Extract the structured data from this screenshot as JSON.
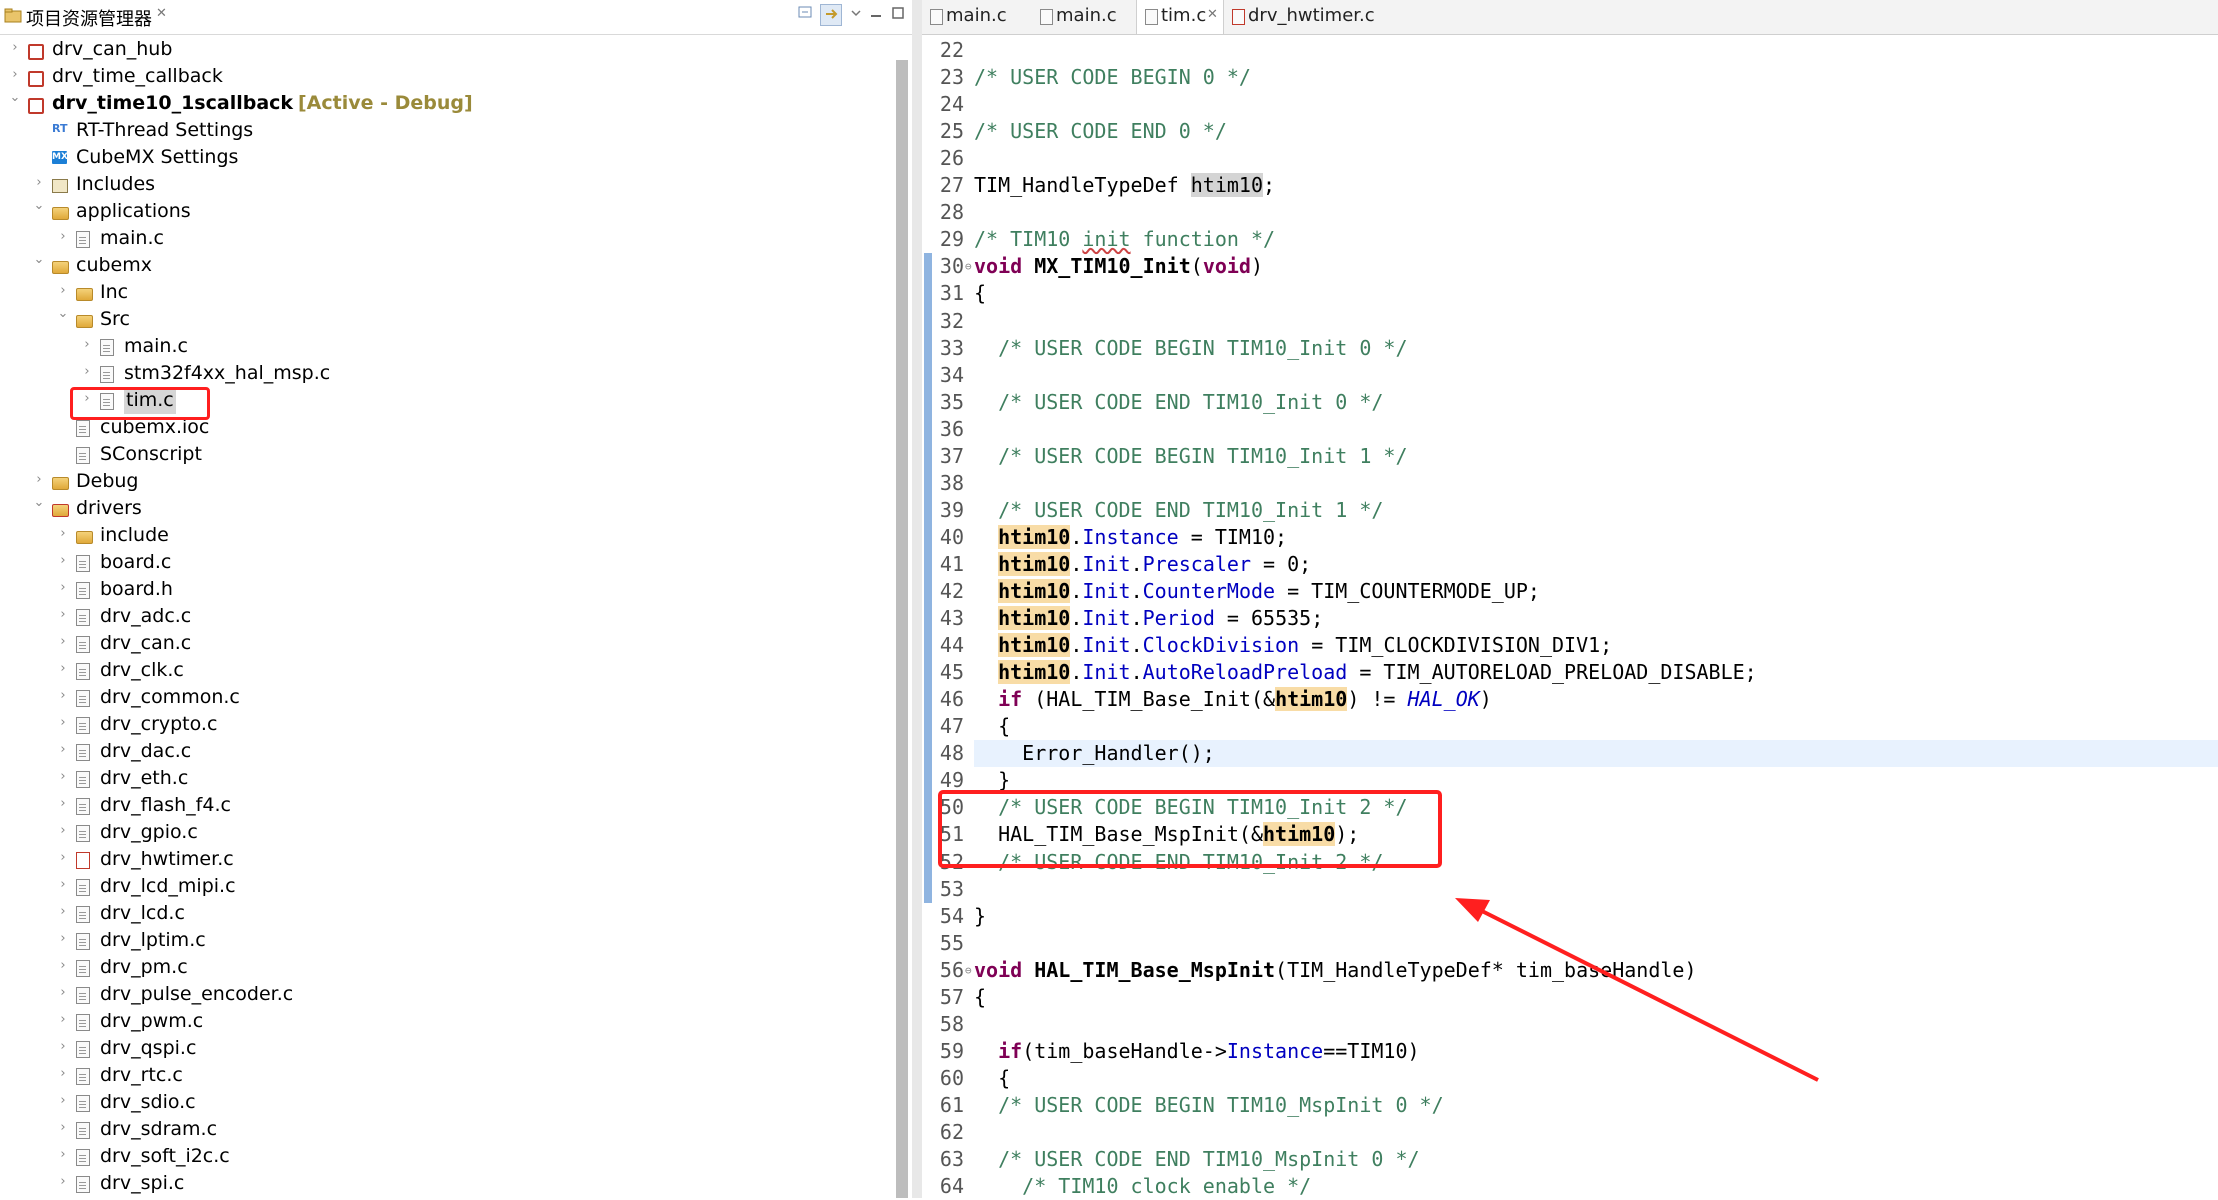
{
  "explorer": {
    "title": "项目资源管理器",
    "close": "✕",
    "toolbar": [
      "collapse",
      "link",
      "menu",
      "minimize",
      "maximize"
    ],
    "items": [
      {
        "label": "drv_can_hub",
        "depth": 0,
        "arrow": "›",
        "icon": "project",
        "bold": false
      },
      {
        "label": "drv_time_callback",
        "depth": 0,
        "arrow": "›",
        "icon": "project",
        "bold": false
      },
      {
        "label": "drv_time10_1scallback",
        "depth": 0,
        "arrow": "⌄",
        "icon": "project",
        "bold": true,
        "deco": "[Active - Debug]"
      },
      {
        "label": "RT-Thread Settings",
        "depth": 1,
        "arrow": "",
        "icon": "rt",
        "bold": false
      },
      {
        "label": "CubeMX Settings",
        "depth": 1,
        "arrow": "",
        "icon": "mx",
        "bold": false
      },
      {
        "label": "Includes",
        "depth": 1,
        "arrow": "›",
        "icon": "includes",
        "bold": false
      },
      {
        "label": "applications",
        "depth": 1,
        "arrow": "⌄",
        "icon": "folder",
        "bold": false
      },
      {
        "label": "main.c",
        "depth": 2,
        "arrow": "›",
        "icon": "file",
        "bold": false
      },
      {
        "label": "cubemx",
        "depth": 1,
        "arrow": "⌄",
        "icon": "folder",
        "bold": false
      },
      {
        "label": "Inc",
        "depth": 2,
        "arrow": "›",
        "icon": "folder",
        "bold": false
      },
      {
        "label": "Src",
        "depth": 2,
        "arrow": "⌄",
        "icon": "folder",
        "bold": false
      },
      {
        "label": "main.c",
        "depth": 3,
        "arrow": "›",
        "icon": "file",
        "bold": false
      },
      {
        "label": "stm32f4xx_hal_msp.c",
        "depth": 3,
        "arrow": "›",
        "icon": "file",
        "bold": false
      },
      {
        "label": "tim.c",
        "depth": 3,
        "arrow": "›",
        "icon": "file",
        "bold": false,
        "selected": true
      },
      {
        "label": "cubemx.ioc",
        "depth": 2,
        "arrow": "",
        "icon": "file",
        "bold": false
      },
      {
        "label": "SConscript",
        "depth": 2,
        "arrow": "",
        "icon": "file",
        "bold": false
      },
      {
        "label": "Debug",
        "depth": 1,
        "arrow": "›",
        "icon": "folder",
        "bold": false
      },
      {
        "label": "drivers",
        "depth": 1,
        "arrow": "⌄",
        "icon": "folder-red",
        "bold": false
      },
      {
        "label": "include",
        "depth": 2,
        "arrow": "›",
        "icon": "folder",
        "bold": false
      },
      {
        "label": "board.c",
        "depth": 2,
        "arrow": "›",
        "icon": "file",
        "bold": false
      },
      {
        "label": "board.h",
        "depth": 2,
        "arrow": "›",
        "icon": "file",
        "bold": false
      },
      {
        "label": "drv_adc.c",
        "depth": 2,
        "arrow": "›",
        "icon": "file",
        "bold": false
      },
      {
        "label": "drv_can.c",
        "depth": 2,
        "arrow": "›",
        "icon": "file",
        "bold": false
      },
      {
        "label": "drv_clk.c",
        "depth": 2,
        "arrow": "›",
        "icon": "file",
        "bold": false
      },
      {
        "label": "drv_common.c",
        "depth": 2,
        "arrow": "›",
        "icon": "file",
        "bold": false
      },
      {
        "label": "drv_crypto.c",
        "depth": 2,
        "arrow": "›",
        "icon": "file",
        "bold": false
      },
      {
        "label": "drv_dac.c",
        "depth": 2,
        "arrow": "›",
        "icon": "file",
        "bold": false
      },
      {
        "label": "drv_eth.c",
        "depth": 2,
        "arrow": "›",
        "icon": "file",
        "bold": false
      },
      {
        "label": "drv_flash_f4.c",
        "depth": 2,
        "arrow": "›",
        "icon": "file",
        "bold": false
      },
      {
        "label": "drv_gpio.c",
        "depth": 2,
        "arrow": "›",
        "icon": "file",
        "bold": false
      },
      {
        "label": "drv_hwtimer.c",
        "depth": 2,
        "arrow": "›",
        "icon": "file-red",
        "bold": false
      },
      {
        "label": "drv_lcd_mipi.c",
        "depth": 2,
        "arrow": "›",
        "icon": "file",
        "bold": false
      },
      {
        "label": "drv_lcd.c",
        "depth": 2,
        "arrow": "›",
        "icon": "file",
        "bold": false
      },
      {
        "label": "drv_lptim.c",
        "depth": 2,
        "arrow": "›",
        "icon": "file",
        "bold": false
      },
      {
        "label": "drv_pm.c",
        "depth": 2,
        "arrow": "›",
        "icon": "file",
        "bold": false
      },
      {
        "label": "drv_pulse_encoder.c",
        "depth": 2,
        "arrow": "›",
        "icon": "file",
        "bold": false
      },
      {
        "label": "drv_pwm.c",
        "depth": 2,
        "arrow": "›",
        "icon": "file",
        "bold": false
      },
      {
        "label": "drv_qspi.c",
        "depth": 2,
        "arrow": "›",
        "icon": "file",
        "bold": false
      },
      {
        "label": "drv_rtc.c",
        "depth": 2,
        "arrow": "›",
        "icon": "file",
        "bold": false
      },
      {
        "label": "drv_sdio.c",
        "depth": 2,
        "arrow": "›",
        "icon": "file",
        "bold": false
      },
      {
        "label": "drv_sdram.c",
        "depth": 2,
        "arrow": "›",
        "icon": "file",
        "bold": false
      },
      {
        "label": "drv_soft_i2c.c",
        "depth": 2,
        "arrow": "›",
        "icon": "file",
        "bold": false
      },
      {
        "label": "drv_spi.c",
        "depth": 2,
        "arrow": "›",
        "icon": "file",
        "bold": false
      }
    ]
  },
  "editor": {
    "tabs": [
      {
        "label": "main.c",
        "active": false,
        "icon": "file"
      },
      {
        "label": "main.c",
        "active": false,
        "icon": "file"
      },
      {
        "label": "tim.c",
        "active": true,
        "icon": "file",
        "close": "✕"
      },
      {
        "label": "drv_hwtimer.c",
        "active": false,
        "icon": "file-red"
      }
    ],
    "lines": [
      {
        "n": "22",
        "tokens": []
      },
      {
        "n": "23",
        "tokens": [
          [
            "cm",
            "/* USER CODE BEGIN 0 */"
          ]
        ]
      },
      {
        "n": "24",
        "tokens": []
      },
      {
        "n": "25",
        "tokens": [
          [
            "cm",
            "/* USER CODE END 0 */"
          ]
        ]
      },
      {
        "n": "26",
        "tokens": []
      },
      {
        "n": "27",
        "tokens": [
          [
            "",
            "TIM_HandleTypeDef "
          ],
          [
            "occ2",
            "htim10"
          ],
          [
            "",
            ";"
          ]
        ]
      },
      {
        "n": "28",
        "tokens": []
      },
      {
        "n": "29",
        "tokens": [
          [
            "cm",
            "/* TIM10 "
          ],
          [
            "cm under",
            "init"
          ],
          [
            "cm",
            " function */"
          ]
        ]
      },
      {
        "n": "30",
        "fold": true,
        "tokens": [
          [
            "kw",
            "void"
          ],
          [
            "",
            " "
          ],
          [
            "fn",
            "MX_TIM10_Init"
          ],
          [
            "",
            "("
          ],
          [
            "kw",
            "void"
          ],
          [
            "",
            ")"
          ]
        ]
      },
      {
        "n": "31",
        "tokens": [
          [
            "",
            "{"
          ]
        ]
      },
      {
        "n": "32",
        "tokens": []
      },
      {
        "n": "33",
        "tokens": [
          [
            "",
            "  "
          ],
          [
            "cm",
            "/* USER CODE BEGIN TIM10_Init 0 */"
          ]
        ]
      },
      {
        "n": "34",
        "tokens": []
      },
      {
        "n": "35",
        "tokens": [
          [
            "",
            "  "
          ],
          [
            "cm",
            "/* USER CODE END TIM10_Init 0 */"
          ]
        ]
      },
      {
        "n": "36",
        "tokens": []
      },
      {
        "n": "37",
        "tokens": [
          [
            "",
            "  "
          ],
          [
            "cm",
            "/* USER CODE BEGIN TIM10_Init 1 */"
          ]
        ]
      },
      {
        "n": "38",
        "tokens": []
      },
      {
        "n": "39",
        "tokens": [
          [
            "",
            "  "
          ],
          [
            "cm",
            "/* USER CODE END TIM10_Init 1 */"
          ]
        ]
      },
      {
        "n": "40",
        "tokens": [
          [
            "",
            "  "
          ],
          [
            "occ",
            "htim10"
          ],
          [
            "",
            "."
          ],
          [
            "fld",
            "Instance"
          ],
          [
            "",
            " = TIM10;"
          ]
        ]
      },
      {
        "n": "41",
        "tokens": [
          [
            "",
            "  "
          ],
          [
            "occ",
            "htim10"
          ],
          [
            "",
            "."
          ],
          [
            "fld",
            "Init"
          ],
          [
            "",
            "."
          ],
          [
            "fld",
            "Prescaler"
          ],
          [
            "",
            " = 0;"
          ]
        ]
      },
      {
        "n": "42",
        "tokens": [
          [
            "",
            "  "
          ],
          [
            "occ",
            "htim10"
          ],
          [
            "",
            "."
          ],
          [
            "fld",
            "Init"
          ],
          [
            "",
            "."
          ],
          [
            "fld",
            "CounterMode"
          ],
          [
            "",
            " = TIM_COUNTERMODE_UP;"
          ]
        ]
      },
      {
        "n": "43",
        "tokens": [
          [
            "",
            "  "
          ],
          [
            "occ",
            "htim10"
          ],
          [
            "",
            "."
          ],
          [
            "fld",
            "Init"
          ],
          [
            "",
            "."
          ],
          [
            "fld",
            "Period"
          ],
          [
            "",
            " = 65535;"
          ]
        ]
      },
      {
        "n": "44",
        "tokens": [
          [
            "",
            "  "
          ],
          [
            "occ",
            "htim10"
          ],
          [
            "",
            "."
          ],
          [
            "fld",
            "Init"
          ],
          [
            "",
            "."
          ],
          [
            "fld",
            "ClockDivision"
          ],
          [
            "",
            " = TIM_CLOCKDIVISION_DIV1;"
          ]
        ]
      },
      {
        "n": "45",
        "tokens": [
          [
            "",
            "  "
          ],
          [
            "occ",
            "htim10"
          ],
          [
            "",
            "."
          ],
          [
            "fld",
            "Init"
          ],
          [
            "",
            "."
          ],
          [
            "fld",
            "AutoReloadPreload"
          ],
          [
            "",
            " = TIM_AUTORELOAD_PRELOAD_DISABLE;"
          ]
        ]
      },
      {
        "n": "46",
        "tokens": [
          [
            "",
            "  "
          ],
          [
            "kw",
            "if"
          ],
          [
            "",
            " (HAL_TIM_Base_Init(&"
          ],
          [
            "occ",
            "htim10"
          ],
          [
            "",
            ") != "
          ],
          [
            "ital",
            "HAL_OK"
          ],
          [
            "",
            ")"
          ]
        ]
      },
      {
        "n": "47",
        "tokens": [
          [
            "",
            "  {"
          ]
        ]
      },
      {
        "n": "48",
        "hl": true,
        "tokens": [
          [
            "",
            "    Error_Handler();"
          ]
        ]
      },
      {
        "n": "49",
        "tokens": [
          [
            "",
            "  }"
          ]
        ]
      },
      {
        "n": "50",
        "tokens": [
          [
            "",
            "  "
          ],
          [
            "cm",
            "/* USER CODE BEGIN TIM10_Init 2 */"
          ]
        ]
      },
      {
        "n": "51",
        "tokens": [
          [
            "",
            "  HAL_TIM_Base_MspInit(&"
          ],
          [
            "occ",
            "htim10"
          ],
          [
            "",
            ");"
          ]
        ]
      },
      {
        "n": "52",
        "tokens": [
          [
            "",
            "  "
          ],
          [
            "cm",
            "/* USER CODE END TIM10_Init 2 */"
          ]
        ]
      },
      {
        "n": "53",
        "tokens": []
      },
      {
        "n": "54",
        "tokens": [
          [
            "",
            "}"
          ]
        ]
      },
      {
        "n": "55",
        "tokens": []
      },
      {
        "n": "56",
        "fold": true,
        "tokens": [
          [
            "kw",
            "void"
          ],
          [
            "",
            " "
          ],
          [
            "fn",
            "HAL_TIM_Base_MspInit"
          ],
          [
            "",
            "(TIM_HandleTypeDef* tim_baseHandle)"
          ]
        ]
      },
      {
        "n": "57",
        "tokens": [
          [
            "",
            "{"
          ]
        ]
      },
      {
        "n": "58",
        "tokens": []
      },
      {
        "n": "59",
        "tokens": [
          [
            "",
            "  "
          ],
          [
            "kw",
            "if"
          ],
          [
            "",
            "(tim_baseHandle->"
          ],
          [
            "fld",
            "Instance"
          ],
          [
            "",
            "==TIM10)"
          ]
        ]
      },
      {
        "n": "60",
        "tokens": [
          [
            "",
            "  {"
          ]
        ]
      },
      {
        "n": "61",
        "tokens": [
          [
            "",
            "  "
          ],
          [
            "cm",
            "/* USER CODE BEGIN TIM10_MspInit 0 */"
          ]
        ]
      },
      {
        "n": "62",
        "tokens": []
      },
      {
        "n": "63",
        "tokens": [
          [
            "",
            "  "
          ],
          [
            "cm",
            "/* USER CODE END TIM10_MspInit 0 */"
          ]
        ]
      },
      {
        "n": "64",
        "tokens": [
          [
            "",
            "    "
          ],
          [
            "cm",
            "/* TIM10 clock enable */"
          ]
        ]
      }
    ]
  },
  "colors": {
    "annotation": "#ff1f1f",
    "keyword": "#7f0055",
    "comment": "#3f7f5f",
    "field": "#0000c0",
    "occurrence": "#f8dca6"
  }
}
